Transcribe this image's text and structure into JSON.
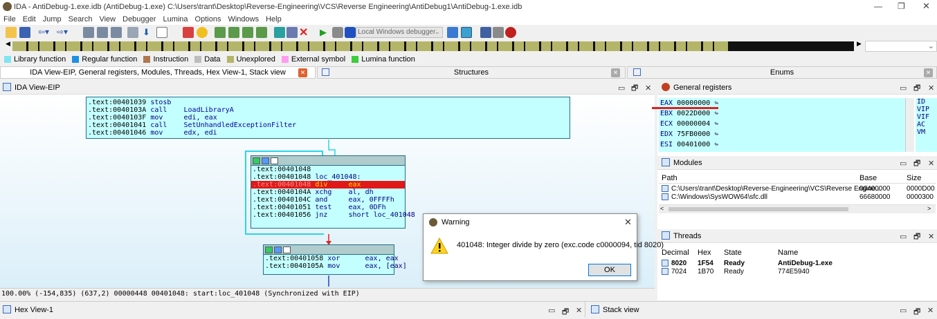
{
  "window": {
    "title": "IDA - AntiDebug-1.exe.idb (AntiDebug-1.exe) C:\\Users\\trant\\Desktop\\Reverse-Engineering\\VCS\\Reverse Engineering\\AntiDebug1\\AntiDebug-1.exe.idb"
  },
  "menu": [
    "File",
    "Edit",
    "Jump",
    "Search",
    "View",
    "Debugger",
    "Lumina",
    "Options",
    "Windows",
    "Help"
  ],
  "toolbar": {
    "debugger_select": "Local Windows debugger"
  },
  "legend": [
    {
      "label": "Library function",
      "color": "#7fe5f0"
    },
    {
      "label": "Regular function",
      "color": "#1e90e0"
    },
    {
      "label": "Instruction",
      "color": "#b07850"
    },
    {
      "label": "Data",
      "color": "#bdbdbd"
    },
    {
      "label": "Unexplored",
      "color": "#b5b56a"
    },
    {
      "label": "External symbol",
      "color": "#ff9cf0"
    },
    {
      "label": "Lumina function",
      "color": "#3ccc3c"
    }
  ],
  "tabs": {
    "main": "IDA View-EIP, General registers, Modules, Threads, Hex View-1, Stack view",
    "structures": "Structures",
    "enums": "Enums"
  },
  "ida_view": {
    "title": "IDA View-EIP",
    "node1": [
      {
        "addr": ".text:00401039",
        "mn": "stosb",
        "op": ""
      },
      {
        "addr": ".text:0040103A",
        "mn": "call",
        "op": "LoadLibraryA"
      },
      {
        "addr": ".text:0040103F",
        "mn": "mov",
        "op": "edi, eax"
      },
      {
        "addr": ".text:00401041",
        "mn": "call",
        "op": "SetUnhandledExceptionFilter"
      },
      {
        "addr": ".text:00401046",
        "mn": "mov",
        "op": "edx, edi"
      }
    ],
    "node2": [
      {
        "addr": ".text:00401048",
        "mn": "",
        "op": ""
      },
      {
        "addr": ".text:00401048",
        "mn": "loc_401048:",
        "op": ""
      },
      {
        "addr": ".text:00401048",
        "mn": "div",
        "op": "eax"
      },
      {
        "addr": ".text:0040104A",
        "mn": "xchg",
        "op": "al, dh"
      },
      {
        "addr": ".text:0040104C",
        "mn": "and",
        "op": "eax, 0FFFFh"
      },
      {
        "addr": ".text:00401051",
        "mn": "test",
        "op": "eax, 0DFh"
      },
      {
        "addr": ".text:00401056",
        "mn": "jnz",
        "op": "short loc_401048"
      }
    ],
    "node3": [
      {
        "addr": ".text:00401058",
        "mn": "xor",
        "op": "eax, eax"
      },
      {
        "addr": ".text:0040105A",
        "mn": "mov",
        "op": "eax, [eax]"
      }
    ],
    "status": "100.00% (-154,835) (637,2) 00000448 00401048: start:loc_401048 (Synchronized with EIP)"
  },
  "registers": {
    "title": "General registers",
    "rows": [
      {
        "name": "EAX",
        "value": "00000000"
      },
      {
        "name": "EBX",
        "value": "0022D000"
      },
      {
        "name": "ECX",
        "value": "00000004"
      },
      {
        "name": "EDX",
        "value": "75FB0000"
      },
      {
        "name": "ESI",
        "value": "00401000"
      }
    ],
    "flags": [
      "ID",
      "VIP",
      "VIF",
      "AC",
      "VM"
    ]
  },
  "modules": {
    "title": "Modules",
    "headers": [
      "Path",
      "Base",
      "Size"
    ],
    "rows": [
      {
        "path": "C:\\Users\\trant\\Desktop\\Reverse-Engineering\\VCS\\Reverse Engine...",
        "base": "00400000",
        "size": "0000D00"
      },
      {
        "path": "C:\\Windows\\SysWOW64\\sfc.dll",
        "base": "66680000",
        "size": "0000300"
      }
    ]
  },
  "threads": {
    "title": "Threads",
    "headers": [
      "Decimal",
      "Hex",
      "State",
      "Name"
    ],
    "rows": [
      {
        "dec": "8020",
        "hex": "1F54",
        "state": "Ready",
        "name": "AntiDebug-1.exe"
      },
      {
        "dec": "7024",
        "hex": "1B70",
        "state": "Ready",
        "name": "774E5940"
      }
    ]
  },
  "dialog": {
    "title": "Warning",
    "message": "401048: Integer divide by zero (exc.code c0000094, tid 8020)",
    "ok": "OK"
  },
  "bottom": {
    "hex_view": "Hex View-1",
    "stack_view": "Stack view"
  }
}
